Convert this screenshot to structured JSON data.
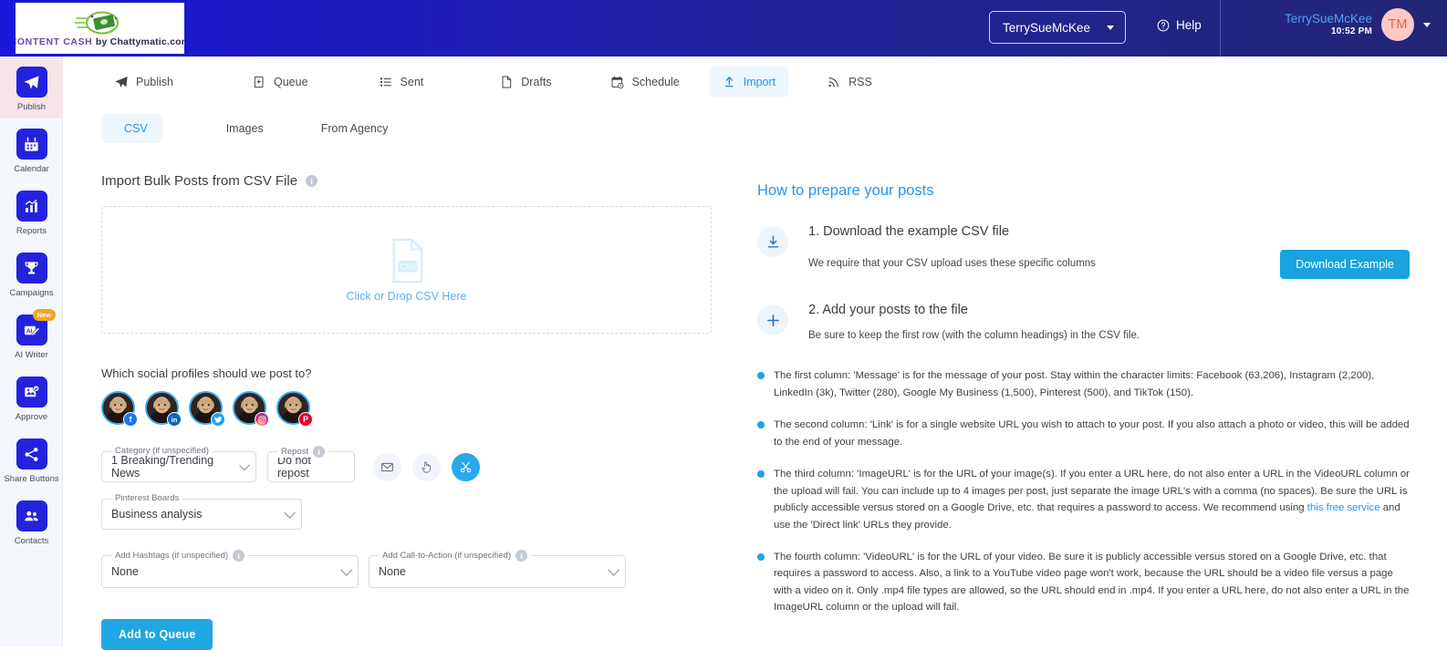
{
  "header": {
    "logo": {
      "brand_primary": "CONTENT CASH",
      "brand_secondary": "by Chattymatic.com",
      "icon": "money-logo-icon"
    },
    "account_select": {
      "label": "TerrySueMcKee",
      "icon": "chevron-down-icon"
    },
    "help": {
      "label": "Help",
      "icon": "help-circle-icon"
    },
    "user": {
      "name": "TerrySueMcKee",
      "time": "10:52 PM",
      "initials": "TM",
      "icon": "chevron-down-icon"
    },
    "colors": {
      "gradient_start": "#1a18d8",
      "gradient_end": "#232575",
      "user_name": "#4da3f5",
      "avatar_bg": "#ffc9c4",
      "avatar_text": "#ee5a52"
    }
  },
  "sidebar": {
    "items": [
      {
        "label": "Publish",
        "icon": "paper-plane-icon",
        "active": true,
        "badge": null
      },
      {
        "label": "Calendar",
        "icon": "calendar-icon",
        "active": false,
        "badge": null
      },
      {
        "label": "Reports",
        "icon": "bar-chart-icon",
        "active": false,
        "badge": null
      },
      {
        "label": "Campaigns",
        "icon": "trophy-icon",
        "active": false,
        "badge": null
      },
      {
        "label": "AI Writer",
        "icon": "ai-pencil-icon",
        "active": false,
        "badge": "New"
      },
      {
        "label": "Approve",
        "icon": "image-check-icon",
        "active": false,
        "badge": null
      },
      {
        "label": "Share Buttons",
        "icon": "share-nodes-icon",
        "active": false,
        "badge": null
      },
      {
        "label": "Contacts",
        "icon": "users-icon",
        "active": false,
        "badge": null
      }
    ],
    "colors": {
      "background": "#f4f8fd",
      "icon_tile": "#2323dd",
      "active_row": "#f7e4e9",
      "badge": "#f5a623"
    }
  },
  "tabs": {
    "primary": [
      {
        "label": "Publish",
        "icon": "paper-plane-icon",
        "active": false
      },
      {
        "label": "Queue",
        "icon": "queue-plus-icon",
        "active": false
      },
      {
        "label": "Sent",
        "icon": "list-icon",
        "active": false
      },
      {
        "label": "Drafts",
        "icon": "file-icon",
        "active": false
      },
      {
        "label": "Schedule",
        "icon": "calendar-clock-icon",
        "active": false
      },
      {
        "label": "Import",
        "icon": "import-upload-icon",
        "active": true
      },
      {
        "label": "RSS",
        "icon": "rss-icon",
        "active": false
      }
    ],
    "secondary": [
      {
        "label": "CSV",
        "icon": "csv-file-icon",
        "active": true
      },
      {
        "label": "Images",
        "icon": "image-icon",
        "active": false
      },
      {
        "label": "From Agency",
        "icon": "rocket-icon",
        "active": false
      }
    ],
    "active_color": "#2196f3",
    "active_bg": "#eef6fe"
  },
  "import": {
    "section_title": "Import Bulk Posts from CSV File",
    "section_info_icon": "info-icon",
    "dropzone": {
      "text": "Click or Drop CSV Here",
      "icon": "csv-file-icon"
    },
    "profiles_question": "Which social profiles should we post to?",
    "profiles": [
      {
        "platform": "Facebook",
        "badge_icon": "facebook-icon",
        "selected": true
      },
      {
        "platform": "LinkedIn",
        "badge_icon": "linkedin-icon",
        "selected": true
      },
      {
        "platform": "Twitter",
        "badge_icon": "twitter-icon",
        "selected": true
      },
      {
        "platform": "Instagram",
        "badge_icon": "instagram-icon",
        "selected": true
      },
      {
        "platform": "Pinterest",
        "badge_icon": "pinterest-icon",
        "selected": true
      }
    ],
    "fields": {
      "category": {
        "legend": "Category (if unspecified)",
        "value": "1 Breaking/Trending News"
      },
      "repost": {
        "legend": "Repost",
        "value": "Do not repost",
        "info_icon": "info-icon"
      },
      "pinterest_boards": {
        "legend": "Pinterest Boards",
        "value": "Business analysis"
      },
      "hashtags": {
        "legend": "Add Hashtags (if unspecified)",
        "value": "None",
        "info_icon": "info-icon"
      },
      "cta": {
        "legend": "Add Call-to-Action (if unspecified)",
        "value": "None",
        "info_icon": "info-icon"
      }
    },
    "action_icons": [
      {
        "icon": "envelope-icon",
        "active": false
      },
      {
        "icon": "hand-pointer-icon",
        "active": false
      },
      {
        "icon": "scissors-icon",
        "active": true
      }
    ],
    "submit_label": "Add to Queue",
    "colors": {
      "submit": "#20a7e2",
      "link": "#58b4f5"
    }
  },
  "help_panel": {
    "title": "How to prepare your posts",
    "steps": [
      {
        "icon": "download-icon",
        "heading": "1. Download the example CSV file",
        "paragraph": "We require that your CSV upload uses these specific columns",
        "button": "Download Example"
      },
      {
        "icon": "plus-icon",
        "heading": "2. Add your posts to the file",
        "paragraph": "Be sure to keep the first row (with the column headings) in the CSV file.",
        "button": null
      }
    ],
    "bullets": [
      {
        "text_before": "The first column: 'Message' is for the message of your post. Stay within the character limits: Facebook (63,206), Instagram (2,200), LinkedIn (3k), Twitter (280), Google My Business (1,500), Pinterest (500), and TikTok (150).",
        "link": null,
        "text_after": null
      },
      {
        "text_before": "The second column: 'Link' is for a single website URL you wish to attach to your post. If you also attach a photo or video, this will be added to the end of your message.",
        "link": null,
        "text_after": null
      },
      {
        "text_before": "The third column: 'ImageURL' is for the URL of your image(s). If you enter a URL here, do not also enter a URL in the VideoURL column or the upload will fail. You can include up to 4 images per post, just separate the image URL's with a comma (no spaces). Be sure the URL is publicly accessible versus stored on a Google Drive, etc. that requires a password to access. We recommend using ",
        "link": "this free service",
        "text_after": " and use the 'Direct link' URLs they provide."
      },
      {
        "text_before": "The fourth column: 'VideoURL' is for the URL of your video. Be sure it is publicly accessible versus stored on a Google Drive, etc. that requires a password to access. Also, a link to a YouTube video page won't work, because the URL should be a video file versus a page with a video on it. Only .mp4 file types are allowed, so the URL should end in .mp4. If you enter a URL here, do not also enter a URL in the ImageURL column or the upload will fail.",
        "link": null,
        "text_after": null
      }
    ],
    "colors": {
      "title": "#2196f3",
      "bullet_dot": "#1fa2e8",
      "button": "#19a3e0"
    }
  }
}
